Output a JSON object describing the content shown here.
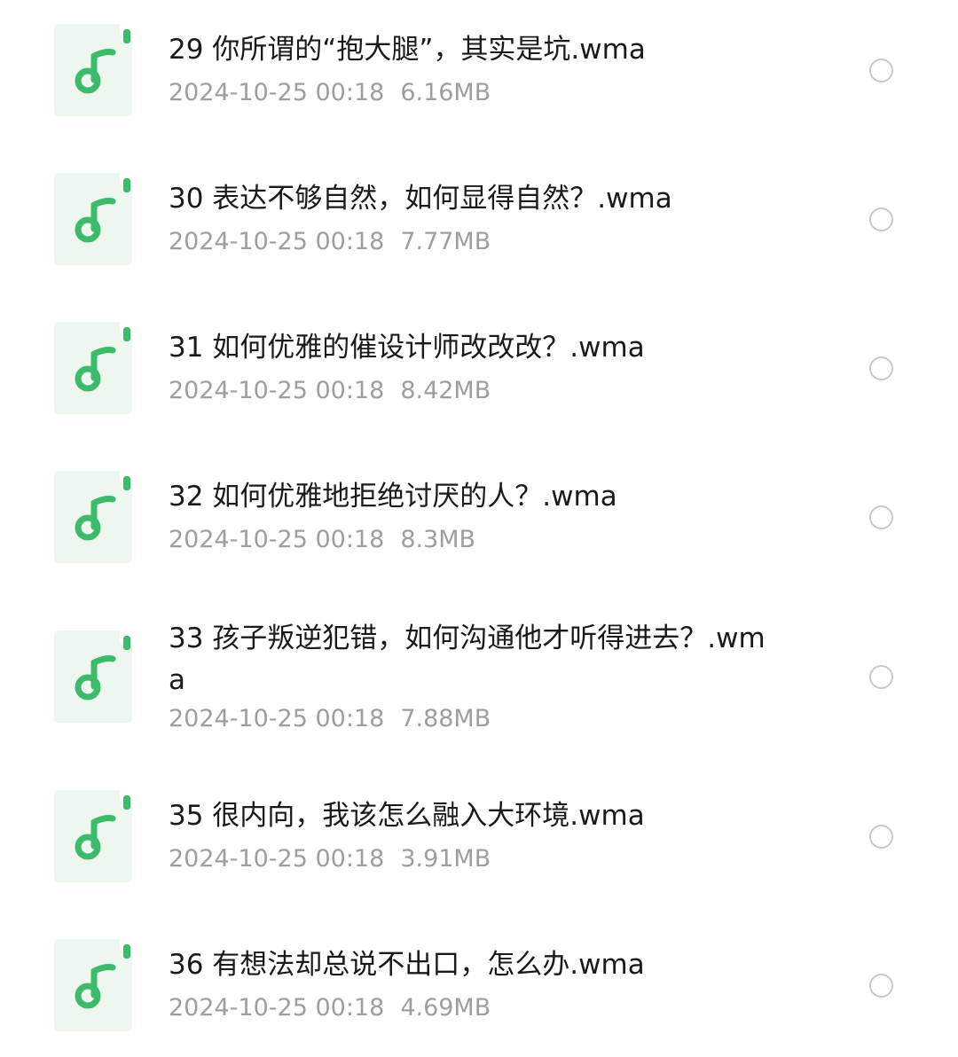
{
  "files": [
    {
      "name": "29 你所谓的“抱大腿”，其实是坑.wma",
      "date": "2024-10-25 00:18",
      "size": "6.16MB"
    },
    {
      "name": "30 表达不够自然，如何显得自然？.wma",
      "date": "2024-10-25 00:18",
      "size": "7.77MB"
    },
    {
      "name": "31 如何优雅的催设计师改改改？.wma",
      "date": "2024-10-25 00:18",
      "size": "8.42MB"
    },
    {
      "name": "32 如何优雅地拒绝讨厌的人？.wma",
      "date": "2024-10-25 00:18",
      "size": "8.3MB"
    },
    {
      "name": "33 孩子叛逆犯错，如何沟通他才听得进去？.wma",
      "date": "2024-10-25 00:18",
      "size": "7.88MB"
    },
    {
      "name": "35 很内向，我该怎么融入大环境.wma",
      "date": "2024-10-25 00:18",
      "size": "3.91MB"
    },
    {
      "name": "36 有想法却总说不出口，怎么办.wma",
      "date": "2024-10-25 00:18",
      "size": "4.69MB"
    }
  ],
  "icon": "music-file-icon",
  "colors": {
    "icon_bg": "#eef6f0",
    "icon_fold": "#ffffff",
    "icon_accent": "#3dbb6b",
    "name_text": "#1a1a1a",
    "meta_text": "#9e9e9e",
    "radio_border": "#c9c9c9"
  }
}
